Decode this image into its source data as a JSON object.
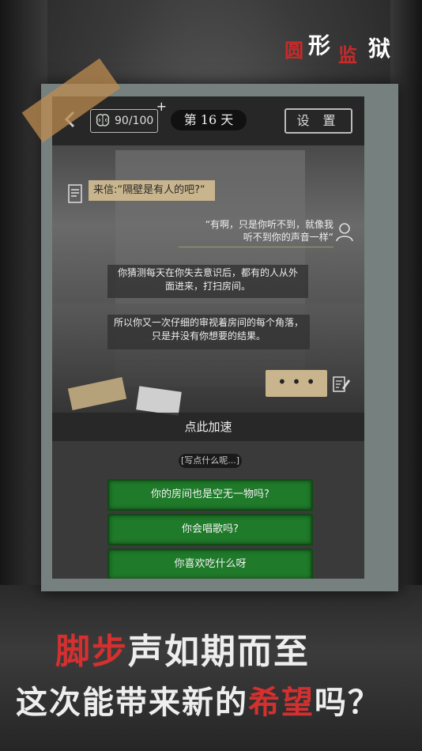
{
  "logo": {
    "c1": "圆",
    "c2": "形",
    "c3": "监",
    "c4": "狱"
  },
  "topbar": {
    "back_icon": "chevron-left-icon",
    "brain_value": "90/100",
    "brain_plus": "+",
    "day_label": "第 16 天",
    "settings_label": "设 置"
  },
  "chat": {
    "letter": "来信:“隔壁是有人的吧?“",
    "reply_line1": "“有啊，只是你听不到，就像我",
    "reply_line2": "听不到你的声音一样“",
    "narration1_line1": "你猜测每天在你失去意识后，都有的人从外",
    "narration1_line2": "面进来，打扫房间。",
    "narration2_line1": "所以你又一次仔细的审视着房间的每个角落，",
    "narration2_line2": "只是并没有你想要的结果。",
    "typing": "• • •"
  },
  "speedup_label": "点此加速",
  "prompt_label": "[写点什么呢...]",
  "choices": [
    "你的房间也是空无一物吗?",
    "你会唱歌吗?",
    "你喜欢吃什么呀"
  ],
  "slogan": {
    "line1_red": "脚步",
    "line1_rest": "声如期而至",
    "line2_a": "这次能带来新的",
    "line2_red": "希望",
    "line2_b": "吗？"
  },
  "colors": {
    "accent_red": "#d43030",
    "choice_green": "#1f7a2a",
    "paper": "#c8b58d"
  }
}
